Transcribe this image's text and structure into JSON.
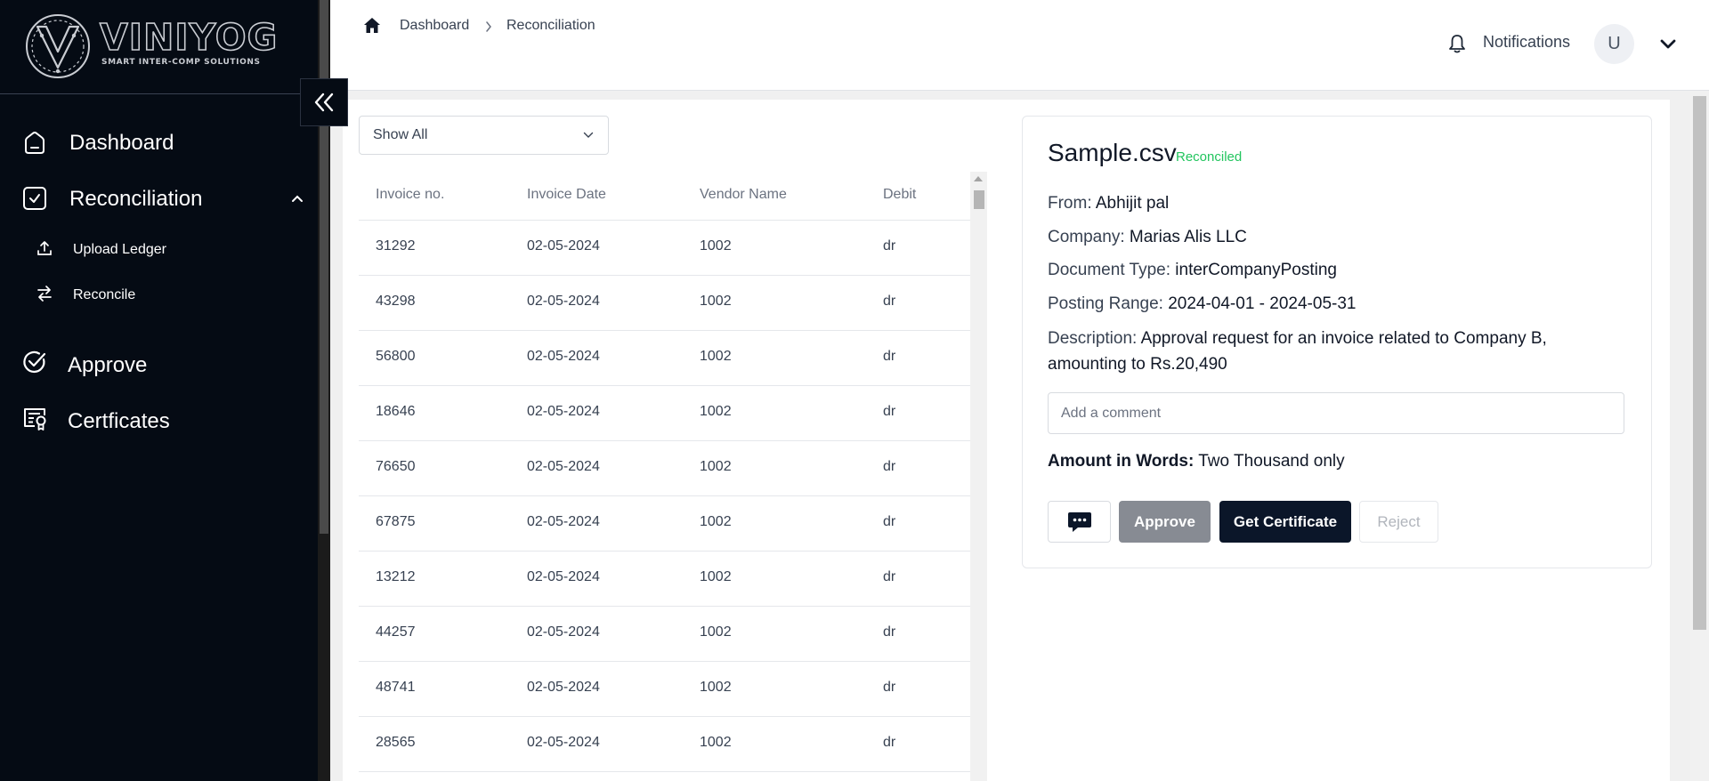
{
  "brand": {
    "name": "VINIYOG",
    "tagline": "SMART INTER-COMP SOLUTIONS"
  },
  "sidebar": {
    "items": [
      {
        "label": "Dashboard",
        "icon": "home-icon"
      },
      {
        "label": "Reconciliation",
        "icon": "check-square-icon",
        "expanded": true
      },
      {
        "label": "Upload Ledger",
        "icon": "upload-icon"
      },
      {
        "label": "Reconcile",
        "icon": "arrows-swap-icon"
      },
      {
        "label": "Approve",
        "icon": "check-circle-icon"
      },
      {
        "label": "Certficates",
        "icon": "certificate-icon"
      }
    ]
  },
  "header": {
    "breadcrumb": [
      "Dashboard",
      "Reconciliation"
    ],
    "notifications_label": "Notifications",
    "avatar_initial": "U"
  },
  "filter": {
    "selected": "Show All"
  },
  "table": {
    "columns": [
      "Invoice no.",
      "Invoice Date",
      "Vendor Name",
      "Debit"
    ],
    "rows": [
      [
        "31292",
        "02-05-2024",
        "1002",
        "dr"
      ],
      [
        "43298",
        "02-05-2024",
        "1002",
        "dr"
      ],
      [
        "56800",
        "02-05-2024",
        "1002",
        "dr"
      ],
      [
        "18646",
        "02-05-2024",
        "1002",
        "dr"
      ],
      [
        "76650",
        "02-05-2024",
        "1002",
        "dr"
      ],
      [
        "67875",
        "02-05-2024",
        "1002",
        "dr"
      ],
      [
        "13212",
        "02-05-2024",
        "1002",
        "dr"
      ],
      [
        "44257",
        "02-05-2024",
        "1002",
        "dr"
      ],
      [
        "48741",
        "02-05-2024",
        "1002",
        "dr"
      ],
      [
        "28565",
        "02-05-2024",
        "1002",
        "dr"
      ]
    ]
  },
  "detail": {
    "file_name": "Sample.csv",
    "status": "Reconciled",
    "from_label": "From:",
    "from_value": "Abhijit pal",
    "company_label": "Company:",
    "company_value": "Marias Alis LLC",
    "doc_type_label": "Document Type:",
    "doc_type_value": "interCompanyPosting",
    "posting_range_label": "Posting Range:",
    "posting_range_value": "2024-04-01 - 2024-05-31",
    "description_label": "Description:",
    "description_value": "Approval request for an invoice related to Company B, amounting to Rs.20,490",
    "comment_placeholder": "Add a comment",
    "amount_words_label": "Amount in Words:",
    "amount_words_value": "Two Thousand only",
    "buttons": {
      "approve": "Approve",
      "certificate": "Get Certificate",
      "reject": "Reject"
    }
  },
  "colors": {
    "sidebar_bg": "#050b14",
    "status_green": "#22c55e",
    "primary_dark": "#0b1629",
    "approve_gray": "#878b93"
  }
}
